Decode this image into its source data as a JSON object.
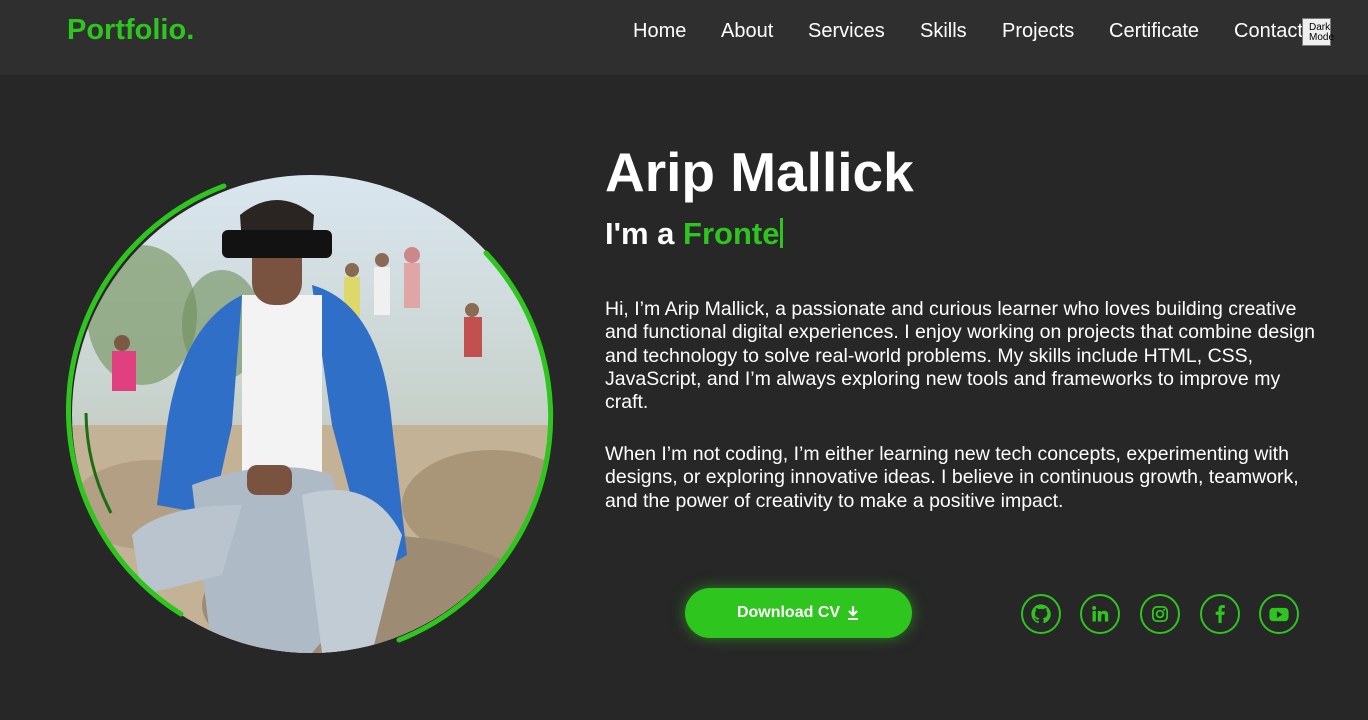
{
  "nav": {
    "logo": "Portfolio.",
    "links": [
      "Home",
      "About",
      "Services",
      "Skills",
      "Projects",
      "Certificate",
      "Contact"
    ],
    "dark_mode_line1": "Dark",
    "dark_mode_line2": "Mode"
  },
  "hero": {
    "name": "Arip Mallick",
    "role_prefix": "I'm a ",
    "role_typed": "Fronte",
    "bio_1": "Hi, I’m Arip Mallick, a passionate and curious learner who loves building creative and functional digital experiences. I enjoy working on projects that combine design and technology to solve real-world problems. My skills include HTML, CSS, JavaScript, and I’m always exploring new tools and frameworks to improve my craft.",
    "bio_2": "When I’m not coding, I’m either learning new tech concepts, experimenting with designs, or exploring innovative ideas. I believe in continuous growth, teamwork, and the power of creativity to make a positive impact.",
    "cv_label": "Download CV"
  },
  "social_icons": [
    "github-icon",
    "linkedin-icon",
    "instagram-icon",
    "facebook-icon",
    "youtube-icon"
  ],
  "colors": {
    "accent": "#2ec51e",
    "background": "#272727",
    "navbar": "#2f2f2f",
    "text": "#ffffff"
  }
}
